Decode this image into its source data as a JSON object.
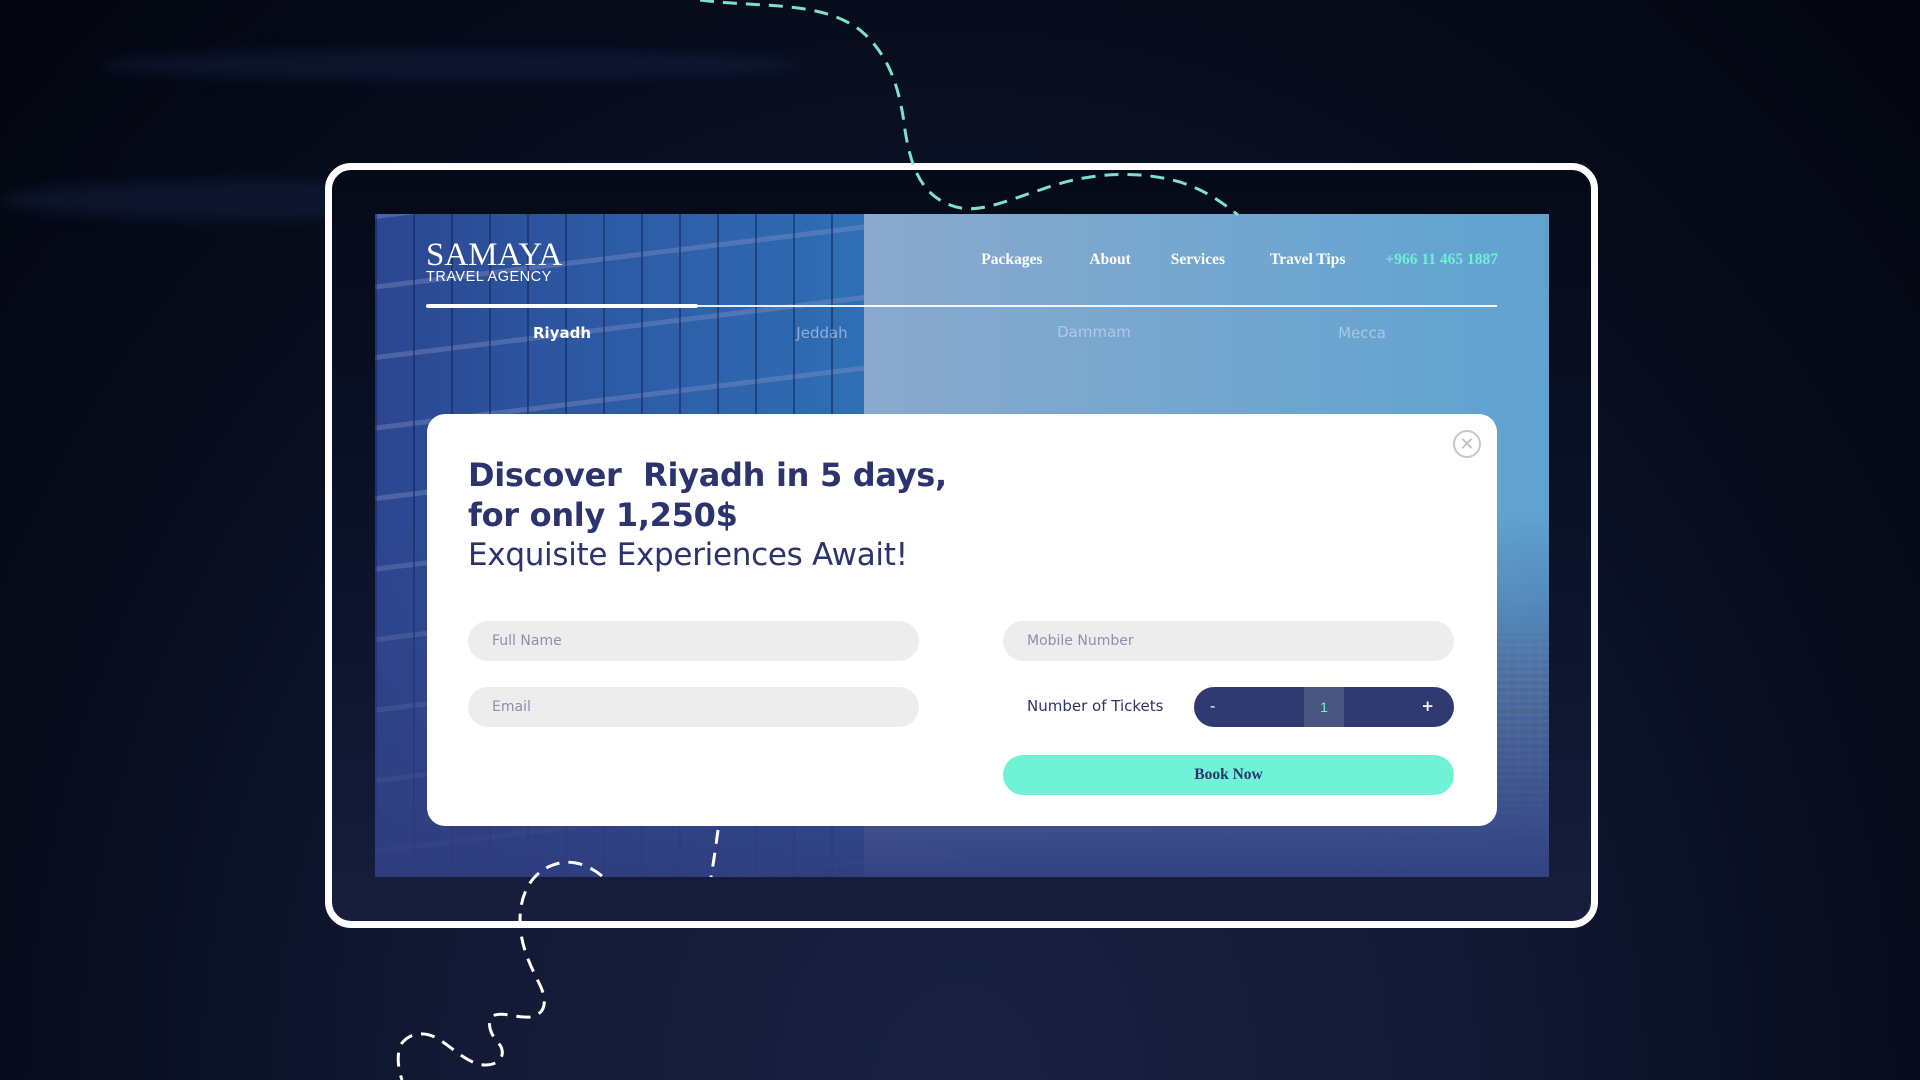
{
  "brand": {
    "name": "SAMAYA",
    "tagline": "TRAVEL AGENCY"
  },
  "nav": {
    "items": [
      {
        "label": "Packages"
      },
      {
        "label": "About"
      },
      {
        "label": "Services"
      },
      {
        "label": "Travel Tips"
      }
    ],
    "phone": "+966 11 465 1887"
  },
  "tabs": [
    {
      "label": "Riyadh",
      "active": true
    },
    {
      "label": "Jeddah",
      "active": false
    },
    {
      "label": "Dammam",
      "active": false
    },
    {
      "label": "Mecca",
      "active": false
    }
  ],
  "modal": {
    "headline_line1": "Discover  Riyadh in 5 days,",
    "headline_line2": "for only 1,250$",
    "subheadline": "Exquisite Experiences Await!",
    "close_icon": "close-circle-icon",
    "fields": {
      "full_name": {
        "placeholder": "Full Name",
        "value": ""
      },
      "email": {
        "placeholder": "Email",
        "value": ""
      },
      "mobile": {
        "placeholder": "Mobile Number",
        "value": ""
      }
    },
    "tickets": {
      "label": "Number of Tickets",
      "minus": "-",
      "value": "1",
      "plus": "+"
    },
    "book_button": "Book Now"
  },
  "colors": {
    "accent": "#6ff2d6",
    "navy": "#2b346e",
    "stepper": "#2f3a70",
    "input_bg": "#ededed"
  }
}
